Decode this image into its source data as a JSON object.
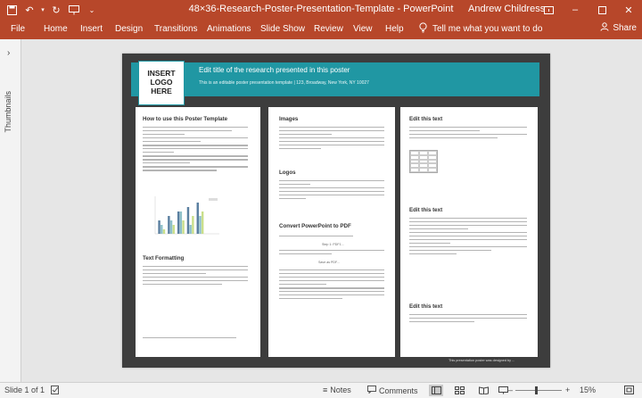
{
  "window": {
    "title": "48×36-Research-Poster-Presentation-Template  -  PowerPoint",
    "user": "Andrew Childress"
  },
  "ribbon": {
    "tabs": [
      "File",
      "Home",
      "Insert",
      "Design",
      "Transitions",
      "Animations",
      "Slide Show",
      "Review",
      "View",
      "Help"
    ],
    "tell_me": "Tell me what you want to do",
    "share": "Share"
  },
  "thumbnails": {
    "label": "Thumbnails"
  },
  "poster": {
    "logo": "INSERT LOGO HERE",
    "title": "Edit title of the research presented in this poster",
    "subtitle": "This is an editable poster presentation template | 123, Broadway, New York, NY 10027",
    "col1": {
      "heading1": "How to use this Poster Template",
      "heading2": "Text Formatting"
    },
    "col2": {
      "heading1": "Images",
      "heading2": "Logos",
      "heading3": "Convert PowerPoint to PDF",
      "step1": "Step 1: PDF1...",
      "step2": "Save as PDF..."
    },
    "col3": {
      "heading1": "Edit this text",
      "heading2": "Edit this text",
      "heading3": "Edit this text"
    },
    "credit": "This presentation poster was designed by ..."
  },
  "chart_data": {
    "type": "bar",
    "categories": [
      "1",
      "2",
      "3",
      "4",
      "5"
    ],
    "series": [
      {
        "values": [
          3,
          4,
          5,
          6,
          7
        ]
      },
      {
        "values": [
          2,
          3,
          5,
          2,
          4
        ]
      },
      {
        "values": [
          1,
          2,
          3,
          4,
          5
        ]
      }
    ],
    "ylim": [
      0,
      8
    ],
    "colors": [
      "#5a7fa0",
      "#8fc1c9",
      "#c9df8a"
    ]
  },
  "statusbar": {
    "slide": "Slide 1 of 1",
    "notes": "Notes",
    "comments": "Comments",
    "zoom": "15%"
  },
  "colors": {
    "accent": "#b7472a",
    "poster_band": "#2097a3",
    "poster_frame": "#3d3d3d"
  }
}
